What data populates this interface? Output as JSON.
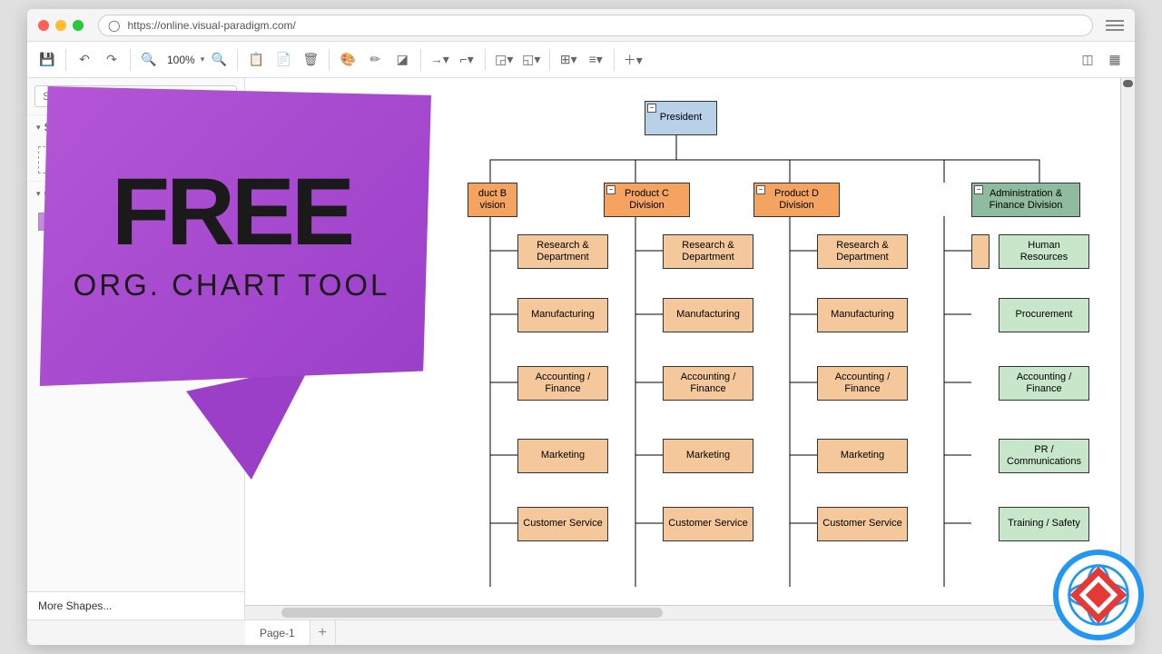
{
  "browser": {
    "url": "https://online.visual-paradigm.com/"
  },
  "toolbar": {
    "zoom": "100%"
  },
  "sidebar": {
    "search_placeholder": "Se",
    "section_scratch": "Sc",
    "section_org": "Or",
    "more_shapes": "More Shapes..."
  },
  "promo": {
    "big": "FREE",
    "sub": "ORG. CHART TOOL"
  },
  "pages": {
    "tab1": "Page-1"
  },
  "org": {
    "president": "President",
    "divisions": {
      "b": "duct B\nvision",
      "c": "Product C\nDivision",
      "d": "Product D\nDivision",
      "admin": "Administration &\nFinance Division"
    },
    "depts": {
      "research": "Research &\nDepartment",
      "manufacturing": "Manufacturing",
      "accounting": "Accounting /\nFinance",
      "marketing": "Marketing",
      "customer": "Customer Service",
      "hr": "Human\nResources",
      "procurement": "Procurement",
      "acc_fin": "Accounting /\nFinance",
      "pr": "PR /\nCommunications",
      "training": "Training / Safety"
    }
  },
  "chart_data": {
    "type": "org-chart",
    "root": {
      "name": "President",
      "children": [
        {
          "name": "Product B Division",
          "children": [
            "Research & Department",
            "Manufacturing",
            "Accounting / Finance",
            "Marketing",
            "Customer Service"
          ]
        },
        {
          "name": "Product C Division",
          "children": [
            "Research & Department",
            "Manufacturing",
            "Accounting / Finance",
            "Marketing",
            "Customer Service"
          ]
        },
        {
          "name": "Product D Division",
          "children": [
            "Research & Department",
            "Manufacturing",
            "Accounting / Finance",
            "Marketing",
            "Customer Service"
          ]
        },
        {
          "name": "Administration & Finance Division",
          "children": [
            "Human Resources",
            "Procurement",
            "Accounting / Finance",
            "PR / Communications",
            "Training / Safety"
          ]
        }
      ]
    }
  }
}
